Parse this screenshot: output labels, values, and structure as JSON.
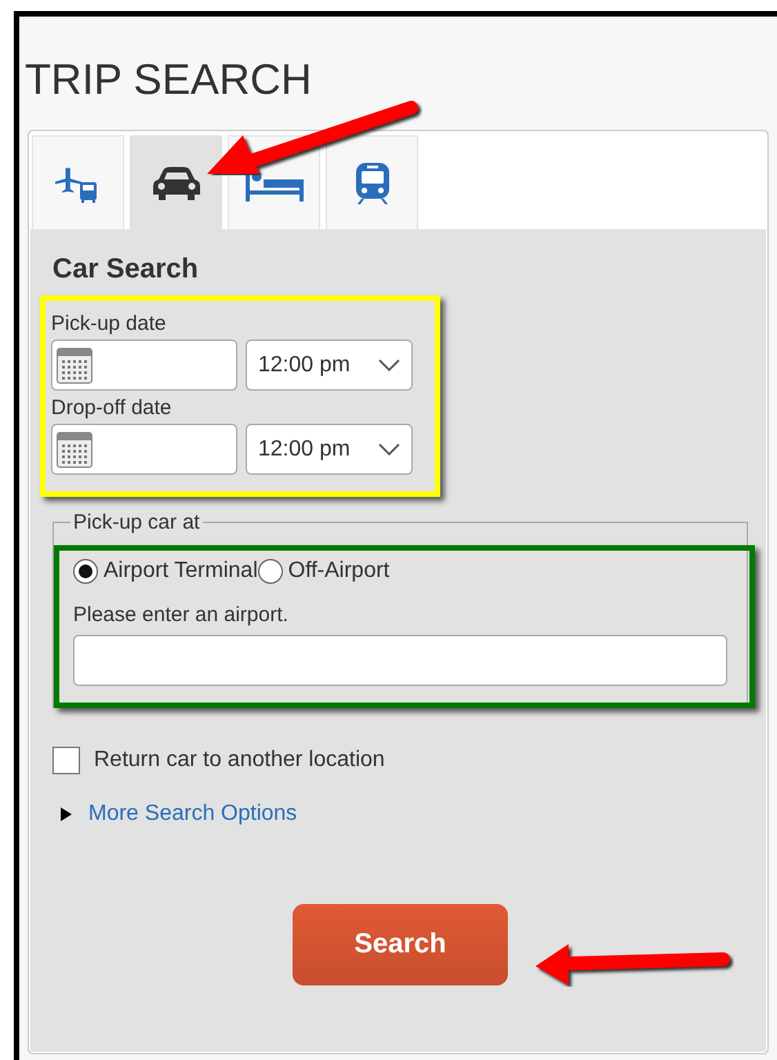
{
  "page": {
    "title": "TRIP SEARCH"
  },
  "tabs": [
    {
      "kind": "flight",
      "selected": false
    },
    {
      "kind": "car",
      "selected": true
    },
    {
      "kind": "hotel",
      "selected": false
    },
    {
      "kind": "train",
      "selected": false
    }
  ],
  "form": {
    "heading": "Car Search",
    "dates": [
      {
        "label": "Pick-up date",
        "time": "12:00 pm"
      },
      {
        "label": "Drop-off date",
        "time": "12:00 pm"
      }
    ],
    "pickup": {
      "legend": "Pick-up car at",
      "options": [
        {
          "label": "Airport Terminal",
          "selected": true
        },
        {
          "label": "Off-Airport",
          "selected": false
        }
      ],
      "prompt": "Please enter an airport."
    },
    "return_elsewhere": {
      "label": "Return car to another location",
      "checked": false
    },
    "more_options": {
      "label": "More Search Options",
      "expanded": false
    },
    "search_button": "Search"
  }
}
